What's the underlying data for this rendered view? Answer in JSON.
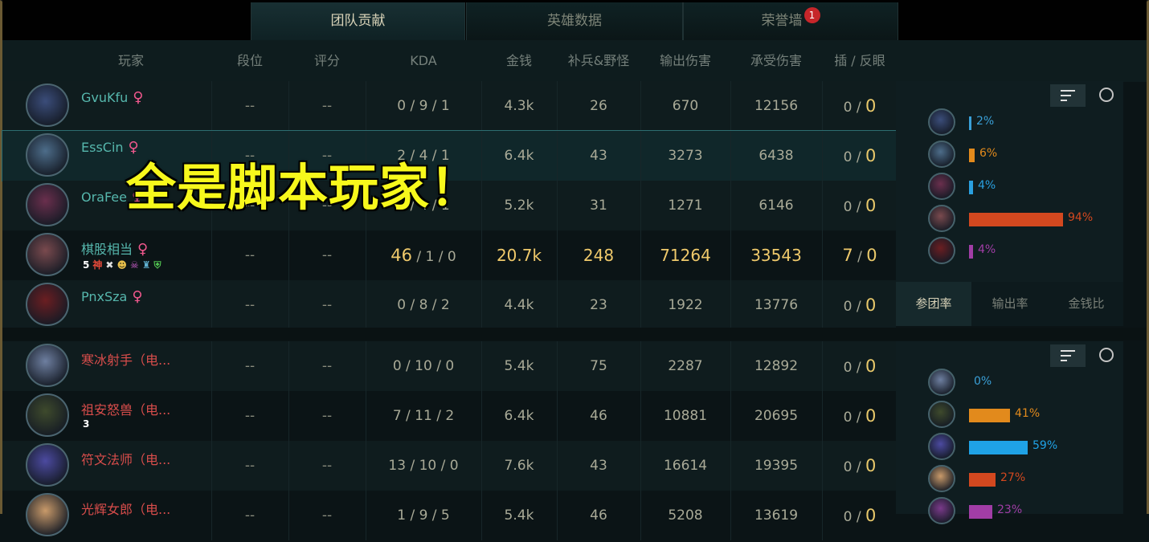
{
  "tabs": [
    {
      "label": "团队贡献",
      "active": true
    },
    {
      "label": "英雄数据",
      "active": false
    },
    {
      "label": "荣誉墙",
      "active": false,
      "badge": "1"
    }
  ],
  "headers": [
    "玩家",
    "段位",
    "评分",
    "KDA",
    "金钱",
    "补兵&野怪",
    "输出伤害",
    "承受伤害",
    "插 / 反眼"
  ],
  "overlay_text": "全是脚本玩家！",
  "team1": [
    {
      "name": "GvuKfu",
      "gender": "♀",
      "rank": "--",
      "score": "--",
      "kda": "0 / 9 / 1",
      "gold": "4.3k",
      "cs": "26",
      "dmg": "670",
      "taken": "12156",
      "wards_a": "0",
      "wards_b": "0",
      "avatar_color": "#3b4d7a"
    },
    {
      "name": "EssCin",
      "gender": "♀",
      "rank": "--",
      "score": "--",
      "kda": "2 / 4 / 1",
      "gold": "6.4k",
      "cs": "43",
      "dmg": "3273",
      "taken": "6438",
      "wards_a": "0",
      "wards_b": "0",
      "avatar_color": "#4d6d8a"
    },
    {
      "name": "OraFee",
      "gender": "♀",
      "rank": "--",
      "score": "--",
      "kda": "1 / 4 / 1",
      "gold": "5.2k",
      "cs": "31",
      "dmg": "1271",
      "taken": "6146",
      "wards_a": "0",
      "wards_b": "0",
      "avatar_color": "#6a2f4d"
    },
    {
      "name": "棋股相当",
      "gender": "♀",
      "rank": "--",
      "score": "--",
      "kda_k": "46",
      "kda_rest": " / 1 / 0",
      "gold": "20.7k",
      "cs": "248",
      "dmg": "71264",
      "taken": "33543",
      "wards_a": "7",
      "wards_b": "0",
      "avatar_color": "#7a4a4e",
      "icons": [
        "5",
        "神",
        "✖",
        "☻",
        "☠",
        "♜",
        "⛨"
      ]
    },
    {
      "name": "PnxSza",
      "gender": "♀",
      "rank": "--",
      "score": "--",
      "kda": "0 / 8 / 2",
      "gold": "4.4k",
      "cs": "23",
      "dmg": "1922",
      "taken": "13776",
      "wards_a": "0",
      "wards_b": "0",
      "avatar_color": "#6b1e22"
    }
  ],
  "team2": [
    {
      "name": "寒冰射手（电...",
      "rank": "--",
      "score": "--",
      "kda": "0 / 10 / 0",
      "gold": "5.4k",
      "cs": "75",
      "dmg": "2287",
      "taken": "12892",
      "wards_a": "0",
      "wards_b": "0",
      "avatar_color": "#6e7fa0"
    },
    {
      "name": "祖安怒兽（电...",
      "rank": "--",
      "score": "--",
      "kda": "7 / 11 / 2",
      "gold": "6.4k",
      "cs": "46",
      "dmg": "10881",
      "taken": "20695",
      "wards_a": "0",
      "wards_b": "0",
      "avatar_color": "#3e4a2c",
      "icons": [
        "3"
      ]
    },
    {
      "name": "符文法师（电...",
      "rank": "--",
      "score": "--",
      "kda": "13 / 10 / 0",
      "gold": "7.6k",
      "cs": "43",
      "dmg": "16614",
      "taken": "19395",
      "wards_a": "0",
      "wards_b": "0",
      "avatar_color": "#4c4aa0"
    },
    {
      "name": "光辉女郎（电...",
      "rank": "--",
      "score": "--",
      "kda": "1 / 9 / 5",
      "gold": "5.4k",
      "cs": "46",
      "dmg": "5208",
      "taken": "13619",
      "wards_a": "0",
      "wards_b": "0",
      "avatar_color": "#c99a6a"
    }
  ],
  "panel_top": {
    "bars": [
      {
        "pct": 2,
        "label": "2%",
        "color": "#3aa0d8"
      },
      {
        "pct": 6,
        "label": "6%",
        "color": "#e28a1c"
      },
      {
        "pct": 4,
        "label": "4%",
        "color": "#2aa0e0"
      },
      {
        "pct": 94,
        "label": "94%",
        "color": "#d3481f"
      },
      {
        "pct": 4,
        "label": "4%",
        "color": "#a13da6"
      }
    ],
    "subtabs": [
      "参团率",
      "输出率",
      "金钱比"
    ]
  },
  "panel_bottom": {
    "bars": [
      {
        "pct": 0,
        "label": "0%",
        "color": "#3aa0d8"
      },
      {
        "pct": 41,
        "label": "41%",
        "color": "#e28a1c"
      },
      {
        "pct": 59,
        "label": "59%",
        "color": "#1fa2e6"
      },
      {
        "pct": 27,
        "label": "27%",
        "color": "#d3481f"
      },
      {
        "pct": 23,
        "label": "23%",
        "color": "#a13da6"
      }
    ]
  }
}
